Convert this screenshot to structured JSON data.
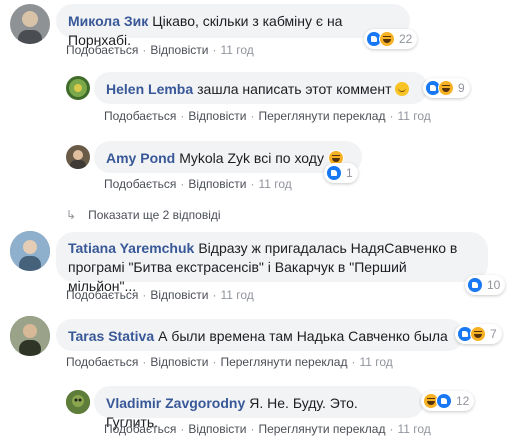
{
  "comments": [
    {
      "author": "Микола Зик",
      "text": "Цікаво, скільки з кабміну є на Порнхабі.",
      "actions": [
        "Подобається",
        "Відповісти",
        "11 год"
      ],
      "reactions": {
        "icons": [
          "like-icon",
          "haha-icon"
        ],
        "count": "22"
      },
      "avatar_color": "#8f9294"
    },
    {
      "author": "Helen Lemba",
      "text": "зашла написать этот коммент",
      "actions": [
        "Подобається",
        "Відповісти",
        "Переглянути переклад",
        "11 год"
      ],
      "reactions": {
        "icons": [
          "like-icon",
          "haha-icon"
        ],
        "count": "9"
      },
      "avatar_color": "#3f6b2a"
    },
    {
      "author": "Amy Pond",
      "text": "Mykola Zyk всі по ходу",
      "actions": [
        "Подобається",
        "Відповісти",
        "11 год"
      ],
      "reactions": {
        "icons": [
          "like-icon"
        ],
        "count": "1"
      },
      "avatar_color": "#6a5a48"
    },
    {
      "author": "Tatiana Yaremchuk",
      "text": "Відразу ж пригадалась НадяСавченко в програмі \"Битва екстрасенсів\" і Вакарчук в \"Перший мільйон\"...",
      "actions": [
        "Подобається",
        "Відповісти",
        "11 год"
      ],
      "reactions": {
        "icons": [
          "like-icon"
        ],
        "count": "10"
      },
      "avatar_color": "#5a7fa6"
    },
    {
      "author": "Taras Stativa",
      "text": "А были времена там Надька Савченко была",
      "actions": [
        "Подобається",
        "Відповісти",
        "Переглянути переклад",
        "11 год"
      ],
      "reactions": {
        "icons": [
          "like-icon",
          "haha-icon"
        ],
        "count": "7"
      },
      "avatar_color": "#4d5a3a"
    },
    {
      "author": "Vladimir Zavgorodny",
      "text": "Я. Не. Буду. Это. Гуглить.",
      "actions": [
        "Подобається",
        "Відповісти",
        "Переглянути переклад",
        "11 год"
      ],
      "reactions": {
        "icons": [
          "haha-icon",
          "like-icon"
        ],
        "count": "12"
      },
      "avatar_color": "#3a5a2a"
    }
  ],
  "more_replies": "Показати ще 2 відповіді",
  "colors": {
    "author": "#385898",
    "bubble": "#f2f3f5",
    "meta": "#90949c",
    "like": "#1877f2",
    "haha": "#f7b125"
  }
}
